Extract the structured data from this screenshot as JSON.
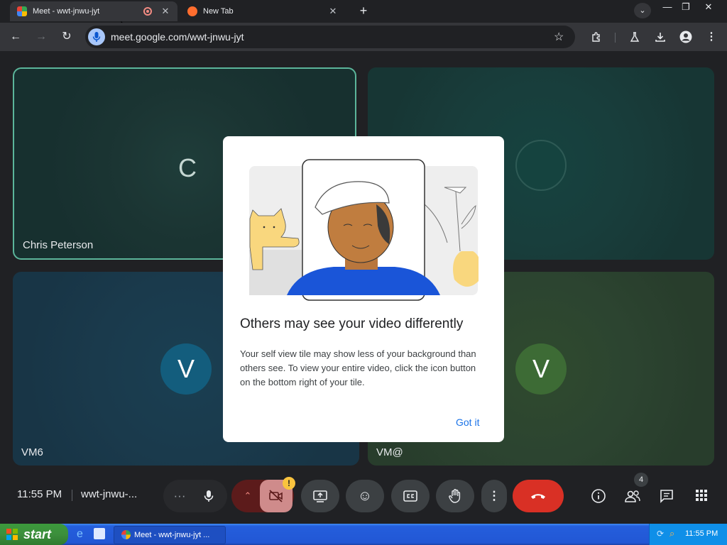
{
  "browser": {
    "tabs": [
      {
        "title": "Meet - wwt-jnwu-jyt",
        "active": true,
        "recording": true
      },
      {
        "title": "New Tab",
        "active": false
      }
    ],
    "new_tab_icon": "plus-icon",
    "window_controls": {
      "minimize": "—",
      "restore": "❐",
      "close": "✕"
    },
    "url": "meet.google.com/wwt-jnwu-jyt",
    "nav": {
      "back": "←",
      "forward": "→",
      "reload": "↻"
    }
  },
  "meet": {
    "tiles": [
      {
        "name": "Chris Peterson",
        "initial": "C",
        "speaking": true
      },
      {
        "name": "",
        "initial": "",
        "connecting": true
      },
      {
        "name": "VM6",
        "initial": "V"
      },
      {
        "name": "VM@",
        "initial": "V"
      }
    ],
    "dialog": {
      "title": "Others may see your video differently",
      "body": "Your self view tile may show less of your background than others see. To view your entire video, click the icon button on the bottom right of your tile.",
      "action": "Got it"
    },
    "controls": {
      "time": "11:55 PM",
      "meeting_code": "wwt-jnwu-...",
      "participant_count": "4",
      "camera_warning": "!"
    }
  },
  "taskbar": {
    "start_label": "start",
    "task_label": "Meet - wwt-jnwu-jyt ...",
    "clock": "11:55 PM"
  },
  "colors": {
    "end_call": "#d93025",
    "accent": "#1a73e8",
    "speaking_border": "#5bb59a"
  }
}
